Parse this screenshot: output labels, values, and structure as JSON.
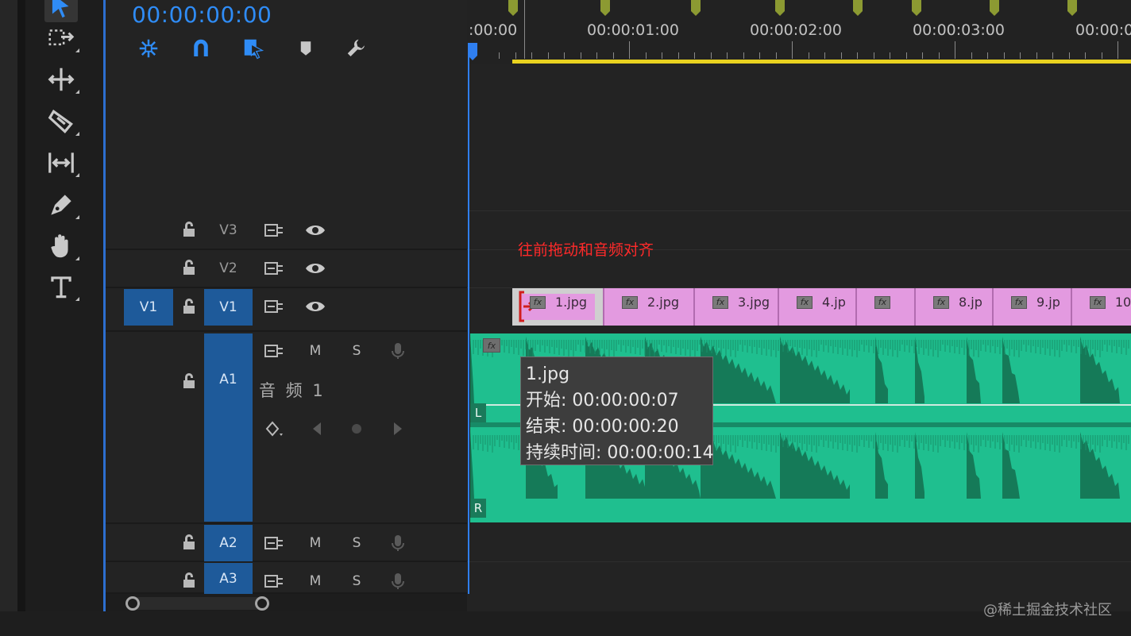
{
  "header": {
    "timecode": "00:00:00:00"
  },
  "ruler": {
    "labels": [
      ":00:00",
      "00:00:01:00",
      "00:00:02:00",
      "00:00:03:00",
      "00:00:0"
    ]
  },
  "tracks": {
    "video": [
      {
        "id": "V3",
        "label": "V3"
      },
      {
        "id": "V2",
        "label": "V2"
      },
      {
        "id": "V1",
        "label": "V1",
        "source_label": "V1"
      }
    ],
    "audio": [
      {
        "id": "A1",
        "label": "A1",
        "name": "音 频 1",
        "mute": "M",
        "solo": "S"
      },
      {
        "id": "A2",
        "label": "A2",
        "mute": "M",
        "solo": "S"
      },
      {
        "id": "A3",
        "label": "A3",
        "mute": "M",
        "solo": "S"
      }
    ]
  },
  "annotation": "往前拖动和音频对齐",
  "clips": [
    {
      "name": "1.jpg",
      "fx": "fx"
    },
    {
      "name": "2.jpg",
      "fx": "fx"
    },
    {
      "name": "3.jpg",
      "fx": "fx"
    },
    {
      "name": "4.jp",
      "fx": "fx"
    },
    {
      "name": "",
      "fx": "fx"
    },
    {
      "name": "8.jp",
      "fx": "fx"
    },
    {
      "name": "9.jp",
      "fx": "fx"
    },
    {
      "name": "10",
      "fx": "fx"
    }
  ],
  "audio_clip": {
    "fx": "fx",
    "left_channel": "L",
    "right_channel": "R"
  },
  "tooltip": {
    "title": "1.jpg",
    "start": "开始: 00:00:00:07",
    "end": "结束: 00:00:00:20",
    "duration": "持续时间: 00:00:00:14"
  },
  "watermark": "@稀土掘金技术社区",
  "colors": {
    "accent": "#2f8cf6",
    "selected_track": "#1e5a9a",
    "clip_pink": "#e39ae0",
    "audio_green": "#1fbf8f",
    "work_area": "#e9d21f",
    "annotation": "#ff2a2a"
  }
}
